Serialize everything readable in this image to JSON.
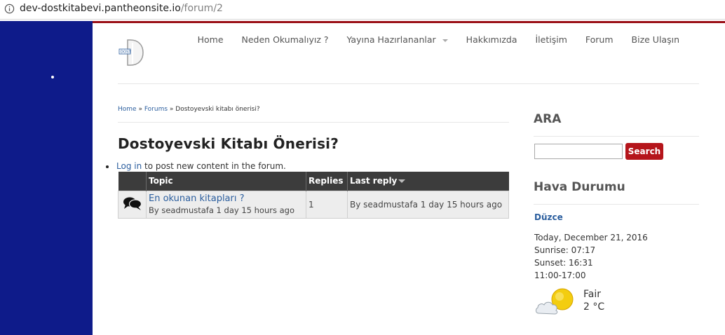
{
  "browser": {
    "url_host": "dev-dostkitabevi.pantheonsite.io",
    "url_path": "/forum/2"
  },
  "nav": {
    "items": [
      "Home",
      "Neden Okumalıyız ?",
      "Yayına Hazırlananlar",
      "Hakkımızda",
      "İletişim",
      "Forum",
      "Bize Ulaşın"
    ]
  },
  "breadcrumb": {
    "home": "Home",
    "sep1": " » ",
    "forums": "Forums",
    "sep2": " » ",
    "current": "Dostoyevski kitabı önerisi?"
  },
  "page": {
    "title": "Dostoyevski Kitabı Önerisi?",
    "login_link": "Log in",
    "login_text": " to post new content in the forum."
  },
  "table": {
    "headers": {
      "topic": "Topic",
      "replies": "Replies",
      "last_reply": "Last reply"
    },
    "rows": [
      {
        "topic": "En okunan kitapları ?",
        "by": "By seadmustafa 1 day 15 hours ago",
        "replies": "1",
        "last_reply": "By seadmustafa 1 day 15 hours ago"
      }
    ]
  },
  "sidebar": {
    "search_heading": "ARA",
    "search_button": "Search",
    "weather_heading": "Hava Durumu",
    "city": "Düzce",
    "date": "Today, December 21, 2016",
    "sunrise": "Sunrise: 07:17",
    "sunset": "Sunset: 16:31",
    "period": "11:00-17:00",
    "condition": "Fair",
    "temperature": "2 °C"
  },
  "colors": {
    "sidebar_blue": "#0e1b8a",
    "accent_red": "#b5151b",
    "link_blue": "#2b5e9e",
    "table_header": "#3c3c3c"
  }
}
